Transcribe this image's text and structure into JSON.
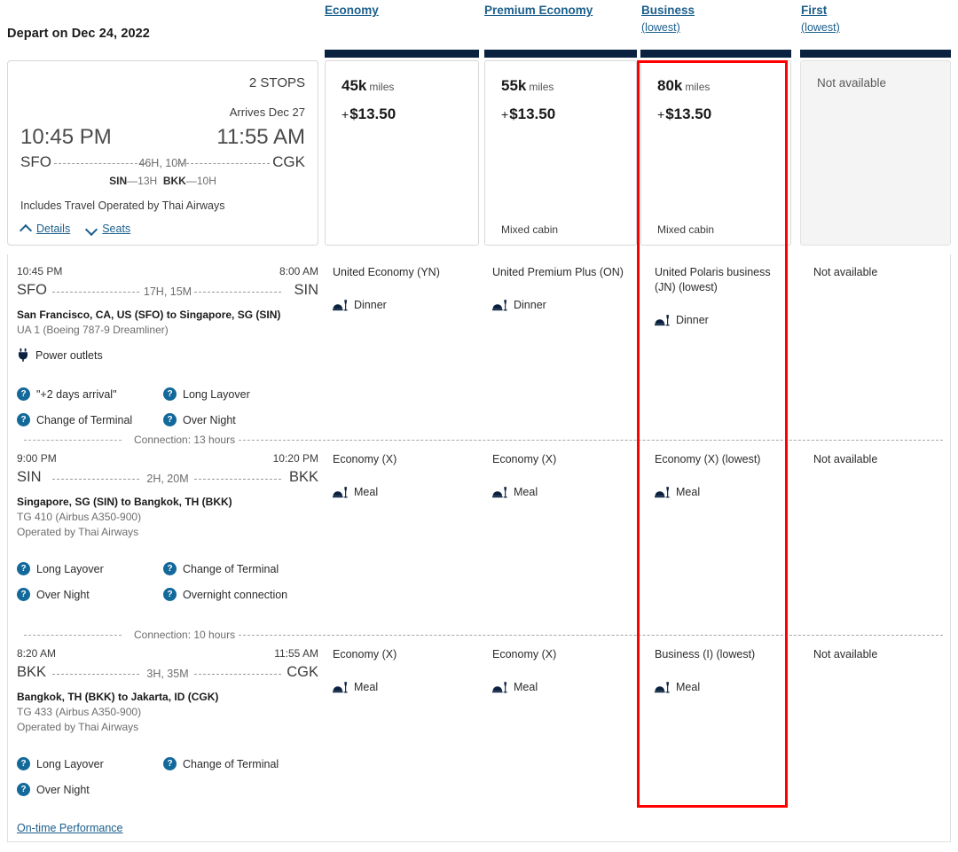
{
  "header": {
    "depart_label": "Depart on Dec 24, 2022",
    "columns": [
      {
        "label": "Economy",
        "sub": ""
      },
      {
        "label": "Premium Economy",
        "sub": ""
      },
      {
        "label": "Business",
        "sub": "(lowest)"
      },
      {
        "label": "First",
        "sub": "(lowest)"
      }
    ]
  },
  "summary": {
    "stops": "2 STOPS",
    "arrives": "Arrives Dec 27",
    "depart_time": "10:45 PM",
    "arrive_time": "11:55 AM",
    "origin": "SFO",
    "destination": "CGK",
    "duration": "46H, 10M",
    "stop1_code": "SIN",
    "stop1_dash": "—",
    "stop1_dur": "13H",
    "stop2_code": "BKK",
    "stop2_dash": "—",
    "stop2_dur": "10H",
    "operated_note": "Includes Travel Operated by Thai Airways",
    "details_label": "Details",
    "seats_label": "Seats"
  },
  "fares": [
    {
      "miles": "45k",
      "miles_unit": "miles",
      "plus": "+",
      "cash": "$13.50",
      "mixed_cabin": "",
      "not_available": ""
    },
    {
      "miles": "55k",
      "miles_unit": "miles",
      "plus": "+",
      "cash": "$13.50",
      "mixed_cabin": "Mixed cabin",
      "not_available": ""
    },
    {
      "miles": "80k",
      "miles_unit": "miles",
      "plus": "+",
      "cash": "$13.50",
      "mixed_cabin": "Mixed cabin",
      "not_available": ""
    },
    {
      "miles": "",
      "miles_unit": "",
      "plus": "",
      "cash": "",
      "mixed_cabin": "",
      "not_available": "Not available"
    }
  ],
  "segments": [
    {
      "dep_time": "10:45 PM",
      "arr_time": "8:00 AM",
      "origin": "SFO",
      "destination": "SIN",
      "duration": "17H, 15M",
      "citypair": "San Francisco, CA, US (SFO) to Singapore, SG (SIN)",
      "equipment": "UA 1 (Boeing 787-9 Dreamliner)",
      "operated": "",
      "amenity": "Power outlets",
      "amenity_icon": "power-plug-icon",
      "badges": [
        "\"+2 days arrival\"",
        "Long Layover",
        "Change of Terminal",
        "Over Night"
      ],
      "cabins": [
        {
          "name": "United Economy (YN)",
          "meal": "Dinner"
        },
        {
          "name": "United Premium Plus (ON)",
          "meal": "Dinner"
        },
        {
          "name": "United Polaris business (JN) (lowest)",
          "meal": "Dinner"
        },
        {
          "name": "Not available",
          "meal": ""
        }
      ],
      "connection": "Connection: 13 hours"
    },
    {
      "dep_time": "9:00 PM",
      "arr_time": "10:20 PM",
      "origin": "SIN",
      "destination": "BKK",
      "duration": "2H, 20M",
      "citypair": "Singapore, SG (SIN) to Bangkok, TH (BKK)",
      "equipment": "TG 410 (Airbus A350-900)",
      "operated": "Operated by Thai Airways",
      "amenity": "",
      "amenity_icon": "",
      "badges": [
        "Long Layover",
        "Change of Terminal",
        "Over Night",
        "Overnight connection"
      ],
      "cabins": [
        {
          "name": "Economy (X)",
          "meal": "Meal"
        },
        {
          "name": "Economy (X)",
          "meal": "Meal"
        },
        {
          "name": "Economy (X) (lowest)",
          "meal": "Meal"
        },
        {
          "name": "Not available",
          "meal": ""
        }
      ],
      "connection": "Connection: 10 hours"
    },
    {
      "dep_time": "8:20 AM",
      "arr_time": "11:55 AM",
      "origin": "BKK",
      "destination": "CGK",
      "duration": "3H, 35M",
      "citypair": "Bangkok, TH (BKK) to Jakarta, ID (CGK)",
      "equipment": "TG 433 (Airbus A350-900)",
      "operated": "Operated by Thai Airways",
      "amenity": "",
      "amenity_icon": "",
      "badges": [
        "Long Layover",
        "Change of Terminal",
        "Over Night"
      ],
      "cabins": [
        {
          "name": "Economy (X)",
          "meal": "Meal"
        },
        {
          "name": "Economy (X)",
          "meal": "Meal"
        },
        {
          "name": "Business (I) (lowest)",
          "meal": "Meal"
        },
        {
          "name": "Not available",
          "meal": ""
        }
      ],
      "connection": ""
    }
  ],
  "footer": {
    "on_time_performance": "On-time Performance"
  },
  "colors": {
    "navy": "#0a2240",
    "link": "#1b5f8c",
    "badge": "#13699a",
    "highlight": "#fe0000",
    "card_border": "#d8d8d8",
    "unavailable_bg": "#f4f4f4"
  }
}
